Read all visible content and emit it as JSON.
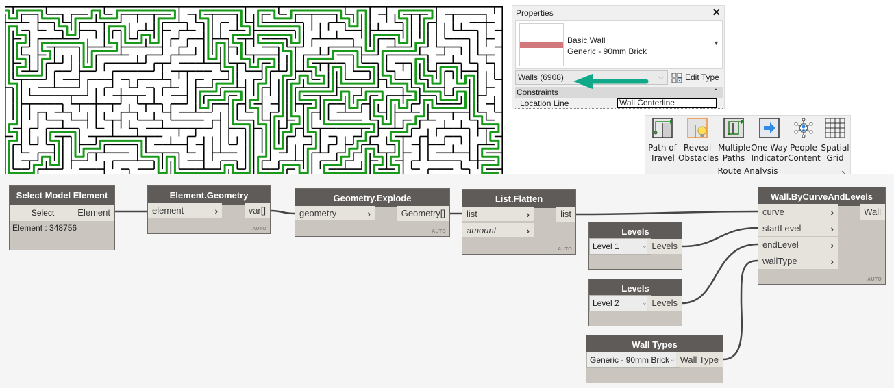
{
  "maze": {
    "wall_color": "#000000",
    "path_color": "#1a9a1a",
    "description": "maze image with solved route highlighted in green"
  },
  "properties": {
    "title": "Properties",
    "close_icon": "close-icon",
    "type_family": "Basic Wall",
    "type_name": "Generic - 90mm Brick",
    "swatch_color": "#d0787c",
    "selector": "Walls (6908)",
    "edit_type_label": "Edit Type",
    "section": "Constraints",
    "rows": [
      {
        "key": "Location Line",
        "value": "Wall Centerline"
      }
    ],
    "annotation_arrow_color": "#12a88a"
  },
  "ribbon": {
    "panel_label": "Route Analysis",
    "buttons": [
      {
        "line1": "Path of",
        "line2": "Travel",
        "icon": "path-of-travel-icon"
      },
      {
        "line1": "Reveal",
        "line2": "Obstacles",
        "icon": "reveal-obstacles-icon"
      },
      {
        "line1": "Multiple",
        "line2": "Paths",
        "icon": "multiple-paths-icon"
      },
      {
        "line1": "One Way",
        "line2": "Indicator",
        "icon": "one-way-indicator-icon"
      },
      {
        "line1": "People",
        "line2": "Content",
        "icon": "people-content-icon"
      },
      {
        "line1": "Spatial",
        "line2": "Grid",
        "icon": "spatial-grid-icon"
      }
    ]
  },
  "graph": {
    "auto_label": "AUTO",
    "nodes": {
      "select": {
        "title": "Select Model Element",
        "button": "Select",
        "output": "Element",
        "info": "Element : 348756"
      },
      "geometry": {
        "title": "Element.Geometry",
        "input": "element",
        "output": "var[]"
      },
      "explode": {
        "title": "Geometry.Explode",
        "input": "geometry",
        "output": "Geometry[]"
      },
      "flatten": {
        "title": "List.Flatten",
        "inputs": [
          "list",
          "amount"
        ],
        "output": "list"
      },
      "levels1": {
        "title": "Levels",
        "selected": "Level 1",
        "output": "Levels"
      },
      "levels2": {
        "title": "Levels",
        "selected": "Level 2",
        "output": "Levels"
      },
      "walltypes": {
        "title": "Wall Types",
        "selected": "Generic - 90mm Brick",
        "output": "Wall Type"
      },
      "wall": {
        "title": "Wall.ByCurveAndLevels",
        "inputs": [
          "curve",
          "startLevel",
          "endLevel",
          "wallType"
        ],
        "output": "Wall"
      }
    }
  }
}
